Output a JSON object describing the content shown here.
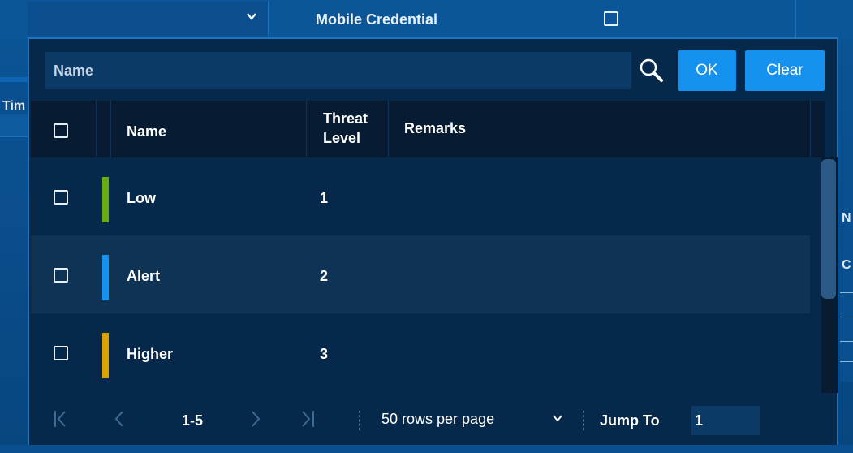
{
  "top_bar": {
    "mobile_credential_label": "Mobile Credential"
  },
  "background": {
    "left_fragment": "Tim",
    "right_fragment_1": "N",
    "right_fragment_2": "C"
  },
  "search": {
    "placeholder": "Name",
    "ok_label": "OK",
    "clear_label": "Clear"
  },
  "table": {
    "columns": {
      "name": "Name",
      "threat_level_line1": "Threat",
      "threat_level_line2": "Level",
      "remarks": "Remarks"
    },
    "rows": [
      {
        "name": "Low",
        "level": "1",
        "color": "#6aaa13"
      },
      {
        "name": "Alert",
        "level": "2",
        "color": "#1591ef"
      },
      {
        "name": "Higher",
        "level": "3",
        "color": "#d9a400"
      }
    ]
  },
  "pagination": {
    "range": "1-5",
    "rows_per_page": "50 rows per page",
    "jump_label": "Jump To",
    "jump_value": "1"
  },
  "colors": {
    "accent": "#1591ef",
    "panel_bg": "#06284a",
    "header_bg": "#071c33"
  }
}
